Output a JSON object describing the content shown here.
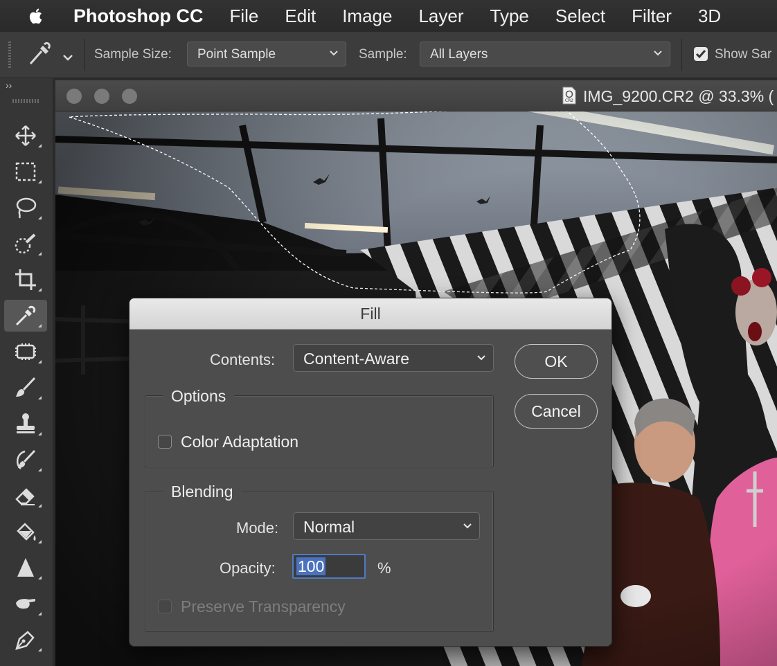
{
  "menubar": {
    "app_name": "Photoshop CC",
    "items": [
      "File",
      "Edit",
      "Image",
      "Layer",
      "Type",
      "Select",
      "Filter",
      "3D"
    ]
  },
  "options_bar": {
    "sample_size_label": "Sample Size:",
    "sample_size_value": "Point Sample",
    "sample_label": "Sample:",
    "sample_value": "All Layers",
    "show_sampling_label": "Show Sar",
    "show_sampling_checked": true
  },
  "tool_panel": {
    "expand_label": "››",
    "tools": [
      {
        "name": "move-tool",
        "icon": "move-icon"
      },
      {
        "name": "marquee-tool",
        "icon": "rectangular-marquee-icon"
      },
      {
        "name": "lasso-tool",
        "icon": "lasso-icon"
      },
      {
        "name": "quick-selection-tool",
        "icon": "quick-selection-icon"
      },
      {
        "name": "crop-tool",
        "icon": "crop-icon"
      },
      {
        "name": "eyedropper-tool",
        "icon": "eyedropper-icon",
        "active": true
      },
      {
        "name": "spot-healing-tool",
        "icon": "healing-icon"
      },
      {
        "name": "brush-tool",
        "icon": "brush-icon"
      },
      {
        "name": "clone-stamp-tool",
        "icon": "stamp-icon"
      },
      {
        "name": "history-brush-tool",
        "icon": "history-brush-icon"
      },
      {
        "name": "eraser-tool",
        "icon": "eraser-icon"
      },
      {
        "name": "paint-bucket-tool",
        "icon": "paint-bucket-icon"
      },
      {
        "name": "sharpen-tool",
        "icon": "sharpen-icon"
      },
      {
        "name": "smudge-tool",
        "icon": "smudge-icon"
      },
      {
        "name": "pen-tool",
        "icon": "pen-icon"
      }
    ]
  },
  "document": {
    "title": "IMG_9200.CR2 @ 33.3% (",
    "file_badge": "CR2"
  },
  "fill_dialog": {
    "title": "Fill",
    "contents_label": "Contents:",
    "contents_value": "Content-Aware",
    "ok_label": "OK",
    "cancel_label": "Cancel",
    "options_title": "Options",
    "color_adaptation_label": "Color Adaptation",
    "color_adaptation_checked": false,
    "blending_title": "Blending",
    "mode_label": "Mode:",
    "mode_value": "Normal",
    "opacity_label": "Opacity:",
    "opacity_value": "100",
    "opacity_unit": "%",
    "preserve_transparency_label": "Preserve Transparency",
    "preserve_transparency_enabled": false
  },
  "colors": {
    "accent_blue": "#4a72bd",
    "dialog_bg": "#4d4d4d",
    "sweater_pink": "#e0609a"
  }
}
